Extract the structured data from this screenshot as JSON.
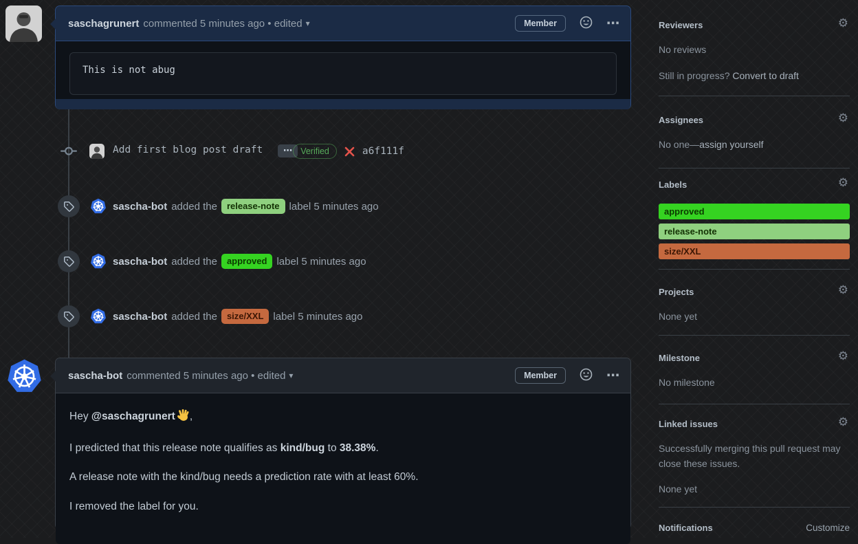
{
  "comment1": {
    "author": "saschagrunert",
    "meta": "commented 5 minutes ago • edited",
    "caret": "▾",
    "member_badge": "Member",
    "kebab": "⋯",
    "code": "This is not abug"
  },
  "commit": {
    "message": "Add first blog post draft",
    "expander": "⋯",
    "verified": "Verified",
    "sha": "a6f111f"
  },
  "label_events": [
    {
      "actor": "sascha-bot",
      "action": "added the",
      "label": "release-note",
      "suffix": "label 5 minutes ago",
      "bg": "#8fd07f",
      "fg": "#123003"
    },
    {
      "actor": "sascha-bot",
      "action": "added the",
      "label": "approved",
      "suffix": "label 5 minutes ago",
      "bg": "#35d321",
      "fg": "#0b3a00"
    },
    {
      "actor": "sascha-bot",
      "action": "added the",
      "label": "size/XXL",
      "suffix": "label 5 minutes ago",
      "bg": "#c5693f",
      "fg": "#3b1604"
    }
  ],
  "comment2": {
    "author": "sascha-bot",
    "meta": "commented 5 minutes ago • edited",
    "caret": "▾",
    "member_badge": "Member",
    "kebab": "⋯",
    "p1_prefix": "Hey ",
    "p1_mention": "@saschagrunert",
    "p1_emoji": "waving-hand",
    "p1_suffix": ",",
    "p2_a": "I predicted that this release note qualifies as ",
    "p2_bold1": "kind/bug",
    "p2_b": " to ",
    "p2_bold2": "38.38%",
    "p2_c": ".",
    "p3": "A release note with the kind/bug needs a prediction rate with at least 60%.",
    "p4": "I removed the label for you."
  },
  "sidebar": {
    "reviewers": {
      "title": "Reviewers",
      "line1": "No reviews",
      "line2_prefix": "Still in progress? ",
      "line2_link": "Convert to draft"
    },
    "assignees": {
      "title": "Assignees",
      "line1_prefix": "No one—",
      "line1_link": "assign yourself"
    },
    "labels": {
      "title": "Labels",
      "items": [
        {
          "name": "approved",
          "bg": "#35d321",
          "fg": "#0b3a00"
        },
        {
          "name": "release-note",
          "bg": "#8fd07f",
          "fg": "#123003"
        },
        {
          "name": "size/XXL",
          "bg": "#c5693f",
          "fg": "#3b1604"
        }
      ]
    },
    "projects": {
      "title": "Projects",
      "line1": "None yet"
    },
    "milestone": {
      "title": "Milestone",
      "line1": "No milestone"
    },
    "linked_issues": {
      "title": "Linked issues",
      "line1": "Successfully merging this pull request may close these issues.",
      "line2": "None yet"
    },
    "notifications": {
      "title": "Notifications",
      "link": "Customize"
    }
  }
}
